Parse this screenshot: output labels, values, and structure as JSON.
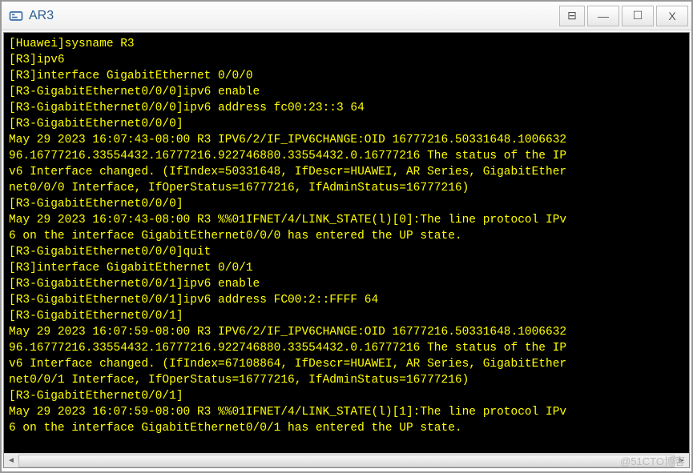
{
  "window": {
    "title": "AR3",
    "minimize_glyph": "—",
    "maximize_glyph": "☐",
    "close_glyph": "X",
    "extra_glyph": "⊟"
  },
  "terminal": {
    "lines": [
      "[Huawei]sysname R3",
      "[R3]ipv6",
      "[R3]interface GigabitEthernet 0/0/0",
      "[R3-GigabitEthernet0/0/0]ipv6 enable",
      "[R3-GigabitEthernet0/0/0]ipv6 address fc00:23::3 64",
      "[R3-GigabitEthernet0/0/0]",
      "May 29 2023 16:07:43-08:00 R3 IPV6/2/IF_IPV6CHANGE:OID 16777216.50331648.1006632",
      "96.16777216.33554432.16777216.922746880.33554432.0.16777216 The status of the IP",
      "v6 Interface changed. (IfIndex=50331648, IfDescr=HUAWEI, AR Series, GigabitEther",
      "net0/0/0 Interface, IfOperStatus=16777216, IfAdminStatus=16777216)",
      "[R3-GigabitEthernet0/0/0]",
      "May 29 2023 16:07:43-08:00 R3 %%01IFNET/4/LINK_STATE(l)[0]:The line protocol IPv",
      "6 on the interface GigabitEthernet0/0/0 has entered the UP state.",
      "[R3-GigabitEthernet0/0/0]quit",
      "[R3]interface GigabitEthernet 0/0/1",
      "[R3-GigabitEthernet0/0/1]ipv6 enable",
      "[R3-GigabitEthernet0/0/1]ipv6 address FC00:2::FFFF 64",
      "[R3-GigabitEthernet0/0/1]",
      "May 29 2023 16:07:59-08:00 R3 IPV6/2/IF_IPV6CHANGE:OID 16777216.50331648.1006632",
      "96.16777216.33554432.16777216.922746880.33554432.0.16777216 The status of the IP",
      "v6 Interface changed. (IfIndex=67108864, IfDescr=HUAWEI, AR Series, GigabitEther",
      "net0/0/1 Interface, IfOperStatus=16777216, IfAdminStatus=16777216)",
      "[R3-GigabitEthernet0/0/1]",
      "May 29 2023 16:07:59-08:00 R3 %%01IFNET/4/LINK_STATE(l)[1]:The line protocol IPv",
      "6 on the interface GigabitEthernet0/0/1 has entered the UP state."
    ]
  },
  "watermark": "@51CTO博客"
}
